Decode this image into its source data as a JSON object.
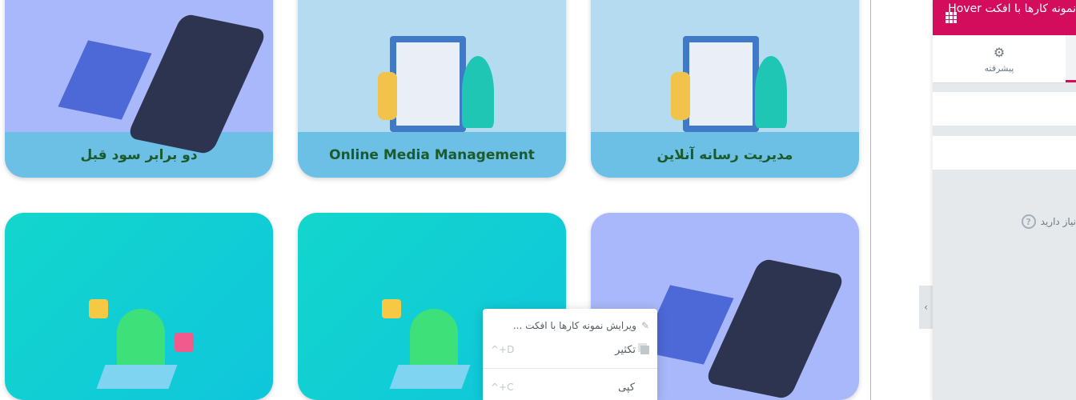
{
  "cards": [
    {
      "title": "مدیریت رسانه آنلاین",
      "theme": "blue"
    },
    {
      "title": "Online Media Management",
      "theme": "blue"
    },
    {
      "title": "دو برابر سود قبل",
      "theme": "purple"
    },
    {
      "title": "",
      "theme": "purple"
    },
    {
      "title": "",
      "theme": "teal"
    },
    {
      "title": "",
      "theme": "teal"
    }
  ],
  "panel": {
    "title": "نمونه کارها با افکت Hover",
    "tab_advanced": "پیشرفته",
    "help_text": "نیاز دارید",
    "help_icon": "?",
    "accent": "#d30c5c"
  },
  "context_menu": {
    "items": [
      {
        "label": "ویرایش نمونه کارها با افکت ...",
        "icon": "pencil-icon",
        "shortcut": ""
      },
      {
        "label": "تکثیر",
        "icon": "duplicate-icon",
        "shortcut": "^+D"
      },
      {
        "label": "کپی",
        "icon": "",
        "shortcut": "^+C"
      }
    ]
  }
}
